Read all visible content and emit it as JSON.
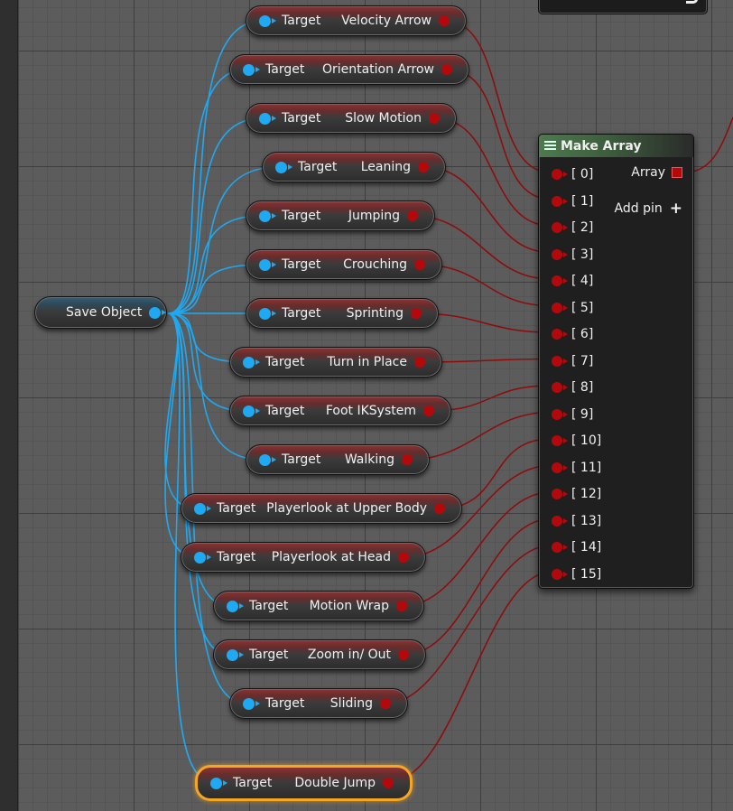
{
  "save_object": {
    "label": "Save Object"
  },
  "target_label": "Target",
  "target_nodes": [
    {
      "name": "Velocity Arrow"
    },
    {
      "name": "Orientation Arrow"
    },
    {
      "name": "Slow Motion"
    },
    {
      "name": "Leaning"
    },
    {
      "name": "Jumping"
    },
    {
      "name": "Crouching"
    },
    {
      "name": "Sprinting"
    },
    {
      "name": "Turn in Place"
    },
    {
      "name": "Foot IKSystem"
    },
    {
      "name": "Walking"
    },
    {
      "name": "Playerlook at Upper Body"
    },
    {
      "name": "Playerlook at Head"
    },
    {
      "name": "Motion Wrap"
    },
    {
      "name": "Zoom in/ Out"
    },
    {
      "name": "Sliding"
    },
    {
      "name": "Double Jump",
      "selected": true
    }
  ],
  "make_array": {
    "title": "Make Array",
    "output_label": "Array",
    "add_pin_label": "Add pin",
    "add_pin_icon": "+",
    "pins": [
      "[ 0]",
      "[ 1]",
      "[ 2]",
      "[ 3]",
      "[ 4]",
      "[ 5]",
      "[ 6]",
      "[ 7]",
      "[ 8]",
      "[ 9]",
      "[ 10]",
      "[ 11]",
      "[ 12]",
      "[ 13]",
      "[ 14]",
      "[ 15]"
    ]
  },
  "colors": {
    "object_pin": "#1ea9f2",
    "array_wire": "#8f0b0b",
    "selection": "#f5a623",
    "make_array_header": "#4e7a4e"
  }
}
